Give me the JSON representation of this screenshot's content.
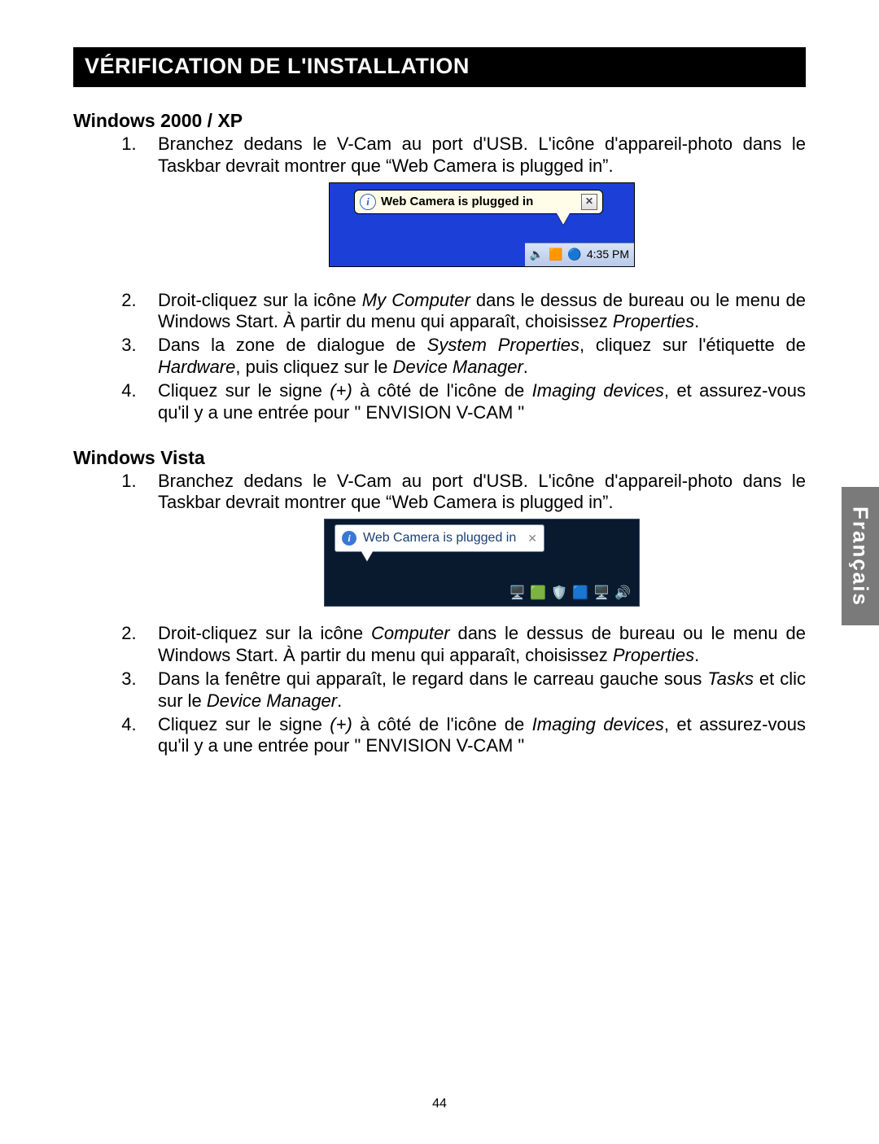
{
  "title": "VÉRIFICATION DE L'INSTALLATION",
  "language_tab": "Français",
  "page_number": "44",
  "xp": {
    "heading": "Windows 2000 / XP",
    "balloon_text": "Web Camera is plugged in",
    "taskbar_time": "4:35 PM",
    "steps": {
      "s1": "Branchez dedans le V-Cam au port d'USB. L'icône d'appareil-photo dans le Taskbar devrait montrer que “Web Camera is plugged in”.",
      "s2_a": "Droit-cliquez sur la icône ",
      "s2_b_i": "My Computer",
      "s2_c": " dans le dessus de bureau ou le menu de Windows Start. À partir du menu qui apparaît, choisissez ",
      "s2_d_i": "Properties",
      "s2_e": ".",
      "s3_a": "Dans la zone de dialogue de ",
      "s3_b_i": "System Properties",
      "s3_c": ", cliquez sur l'étiquette de ",
      "s3_d_i": "Hardware",
      "s3_e": ", puis cliquez sur le ",
      "s3_f_i": "Device Manager",
      "s3_g": ".",
      "s4_a": "Cliquez sur le signe ",
      "s4_b_i": "(+)",
      "s4_c": " à côté de l'icône de ",
      "s4_d_i": "Imaging devices",
      "s4_e": ", et assurez-vous qu'il y a une entrée pour \" ENVISION V-CAM \""
    }
  },
  "vista": {
    "heading": "Windows Vista",
    "balloon_text": "Web Camera is plugged in",
    "steps": {
      "s1": "Branchez dedans le V-Cam au port d'USB. L'icône d'appareil-photo dans le Taskbar devrait montrer que “Web Camera is plugged in”.",
      "s2_a": "Droit-cliquez sur la icône ",
      "s2_b_i": "Computer",
      "s2_c": " dans le dessus de bureau ou le menu de Windows Start. À partir du menu qui apparaît, choisissez ",
      "s2_d_i": "Properties",
      "s2_e": ".",
      "s3_a": "Dans la fenêtre qui apparaît, le regard dans le carreau gauche sous ",
      "s3_b_i": "Tasks",
      "s3_c": " et clic sur le ",
      "s3_d_i": "Device Manager",
      "s3_e": ".",
      "s4_a": "Cliquez sur le signe ",
      "s4_b_i": "(+)",
      "s4_c": " à côté de l'icône de ",
      "s4_d_i": "Imaging devices",
      "s4_e": ", et assurez-vous qu'il y a une entrée pour \" ENVISION V-CAM \""
    }
  }
}
